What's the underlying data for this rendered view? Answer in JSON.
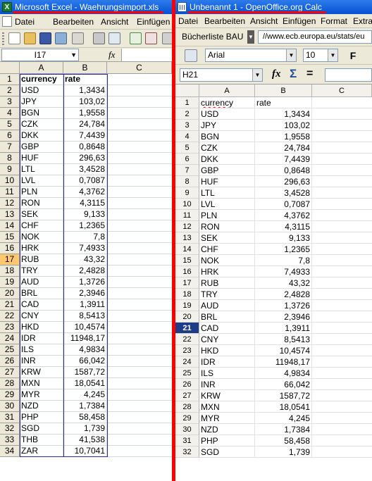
{
  "excel": {
    "title": "Microsoft Excel - Waehrungsimport.xls",
    "app_icon": "X",
    "menu": [
      "Datei",
      "Bearbeiten",
      "Ansicht",
      "Einfügen"
    ],
    "name_box": "I17",
    "fx_label": "fx",
    "columns": [
      "A",
      "B",
      "C"
    ],
    "selected_row": "17",
    "rows": [
      {
        "n": "1",
        "a": "currency",
        "b": "rate"
      },
      {
        "n": "2",
        "a": "USD",
        "b": "1,3434"
      },
      {
        "n": "3",
        "a": "JPY",
        "b": "103,02"
      },
      {
        "n": "4",
        "a": "BGN",
        "b": "1,9558"
      },
      {
        "n": "5",
        "a": "CZK",
        "b": "24,784"
      },
      {
        "n": "6",
        "a": "DKK",
        "b": "7,4439"
      },
      {
        "n": "7",
        "a": "GBP",
        "b": "0,8648"
      },
      {
        "n": "8",
        "a": "HUF",
        "b": "296,63"
      },
      {
        "n": "9",
        "a": "LTL",
        "b": "3,4528"
      },
      {
        "n": "10",
        "a": "LVL",
        "b": "0,7087"
      },
      {
        "n": "11",
        "a": "PLN",
        "b": "4,3762"
      },
      {
        "n": "12",
        "a": "RON",
        "b": "4,3115"
      },
      {
        "n": "13",
        "a": "SEK",
        "b": "9,133"
      },
      {
        "n": "14",
        "a": "CHF",
        "b": "1,2365"
      },
      {
        "n": "15",
        "a": "NOK",
        "b": "7,8"
      },
      {
        "n": "16",
        "a": "HRK",
        "b": "7,4933"
      },
      {
        "n": "17",
        "a": "RUB",
        "b": "43,32"
      },
      {
        "n": "18",
        "a": "TRY",
        "b": "2,4828"
      },
      {
        "n": "19",
        "a": "AUD",
        "b": "1,3726"
      },
      {
        "n": "20",
        "a": "BRL",
        "b": "2,3946"
      },
      {
        "n": "21",
        "a": "CAD",
        "b": "1,3911"
      },
      {
        "n": "22",
        "a": "CNY",
        "b": "8,5413"
      },
      {
        "n": "23",
        "a": "HKD",
        "b": "10,4574"
      },
      {
        "n": "24",
        "a": "IDR",
        "b": "11948,17"
      },
      {
        "n": "25",
        "a": "ILS",
        "b": "4,9834"
      },
      {
        "n": "26",
        "a": "INR",
        "b": "66,042"
      },
      {
        "n": "27",
        "a": "KRW",
        "b": "1587,72"
      },
      {
        "n": "28",
        "a": "MXN",
        "b": "18,0541"
      },
      {
        "n": "29",
        "a": "MYR",
        "b": "4,245"
      },
      {
        "n": "30",
        "a": "NZD",
        "b": "1,7384"
      },
      {
        "n": "31",
        "a": "PHP",
        "b": "58,458"
      },
      {
        "n": "32",
        "a": "SGD",
        "b": "1,739"
      },
      {
        "n": "33",
        "a": "THB",
        "b": "41,538"
      },
      {
        "n": "34",
        "a": "ZAR",
        "b": "10,7041"
      }
    ]
  },
  "calc": {
    "title": "Unbenannt 1 - OpenOffice.org Calc",
    "menu": [
      "Datei",
      "Bearbeiten",
      "Ansicht",
      "Einfügen",
      "Format",
      "Extra"
    ],
    "bookmark_combo": "Bücherliste BAU",
    "url_field": "//www.ecb.europa.eu/stats/eu",
    "font_name": "Arial",
    "font_size": "10",
    "bold_label": "F",
    "name_box": "H21",
    "fx_label": "fx",
    "sigma_label": "Σ",
    "equals_label": "=",
    "columns": [
      "A",
      "B",
      "C"
    ],
    "selected_row": "21",
    "rows": [
      {
        "n": "1",
        "a": "currency",
        "b": "rate"
      },
      {
        "n": "2",
        "a": "USD",
        "b": "1,3434"
      },
      {
        "n": "3",
        "a": "JPY",
        "b": "103,02"
      },
      {
        "n": "4",
        "a": "BGN",
        "b": "1,9558"
      },
      {
        "n": "5",
        "a": "CZK",
        "b": "24,784"
      },
      {
        "n": "6",
        "a": "DKK",
        "b": "7,4439"
      },
      {
        "n": "7",
        "a": "GBP",
        "b": "0,8648"
      },
      {
        "n": "8",
        "a": "HUF",
        "b": "296,63"
      },
      {
        "n": "9",
        "a": "LTL",
        "b": "3,4528"
      },
      {
        "n": "10",
        "a": "LVL",
        "b": "0,7087"
      },
      {
        "n": "11",
        "a": "PLN",
        "b": "4,3762"
      },
      {
        "n": "12",
        "a": "RON",
        "b": "4,3115"
      },
      {
        "n": "13",
        "a": "SEK",
        "b": "9,133"
      },
      {
        "n": "14",
        "a": "CHF",
        "b": "1,2365"
      },
      {
        "n": "15",
        "a": "NOK",
        "b": "7,8"
      },
      {
        "n": "16",
        "a": "HRK",
        "b": "7,4933"
      },
      {
        "n": "17",
        "a": "RUB",
        "b": "43,32"
      },
      {
        "n": "18",
        "a": "TRY",
        "b": "2,4828"
      },
      {
        "n": "19",
        "a": "AUD",
        "b": "1,3726"
      },
      {
        "n": "20",
        "a": "BRL",
        "b": "2,3946"
      },
      {
        "n": "21",
        "a": "CAD",
        "b": "1,3911"
      },
      {
        "n": "22",
        "a": "CNY",
        "b": "8,5413"
      },
      {
        "n": "23",
        "a": "HKD",
        "b": "10,4574"
      },
      {
        "n": "24",
        "a": "IDR",
        "b": "11948,17"
      },
      {
        "n": "25",
        "a": "ILS",
        "b": "4,9834"
      },
      {
        "n": "26",
        "a": "INR",
        "b": "66,042"
      },
      {
        "n": "27",
        "a": "KRW",
        "b": "1587,72"
      },
      {
        "n": "28",
        "a": "MXN",
        "b": "18,0541"
      },
      {
        "n": "29",
        "a": "MYR",
        "b": "4,245"
      },
      {
        "n": "30",
        "a": "NZD",
        "b": "1,7384"
      },
      {
        "n": "31",
        "a": "PHP",
        "b": "58,458"
      },
      {
        "n": "32",
        "a": "SGD",
        "b": "1,739"
      }
    ]
  },
  "colors": {
    "annotation_red": "#ff0000",
    "titlebar_blue": "#0551d4",
    "excel_selected_row_header": "#ffc76e",
    "calc_selected_row_header": "#1f3c88",
    "excel_highlight_border": "#2a2aa8"
  }
}
